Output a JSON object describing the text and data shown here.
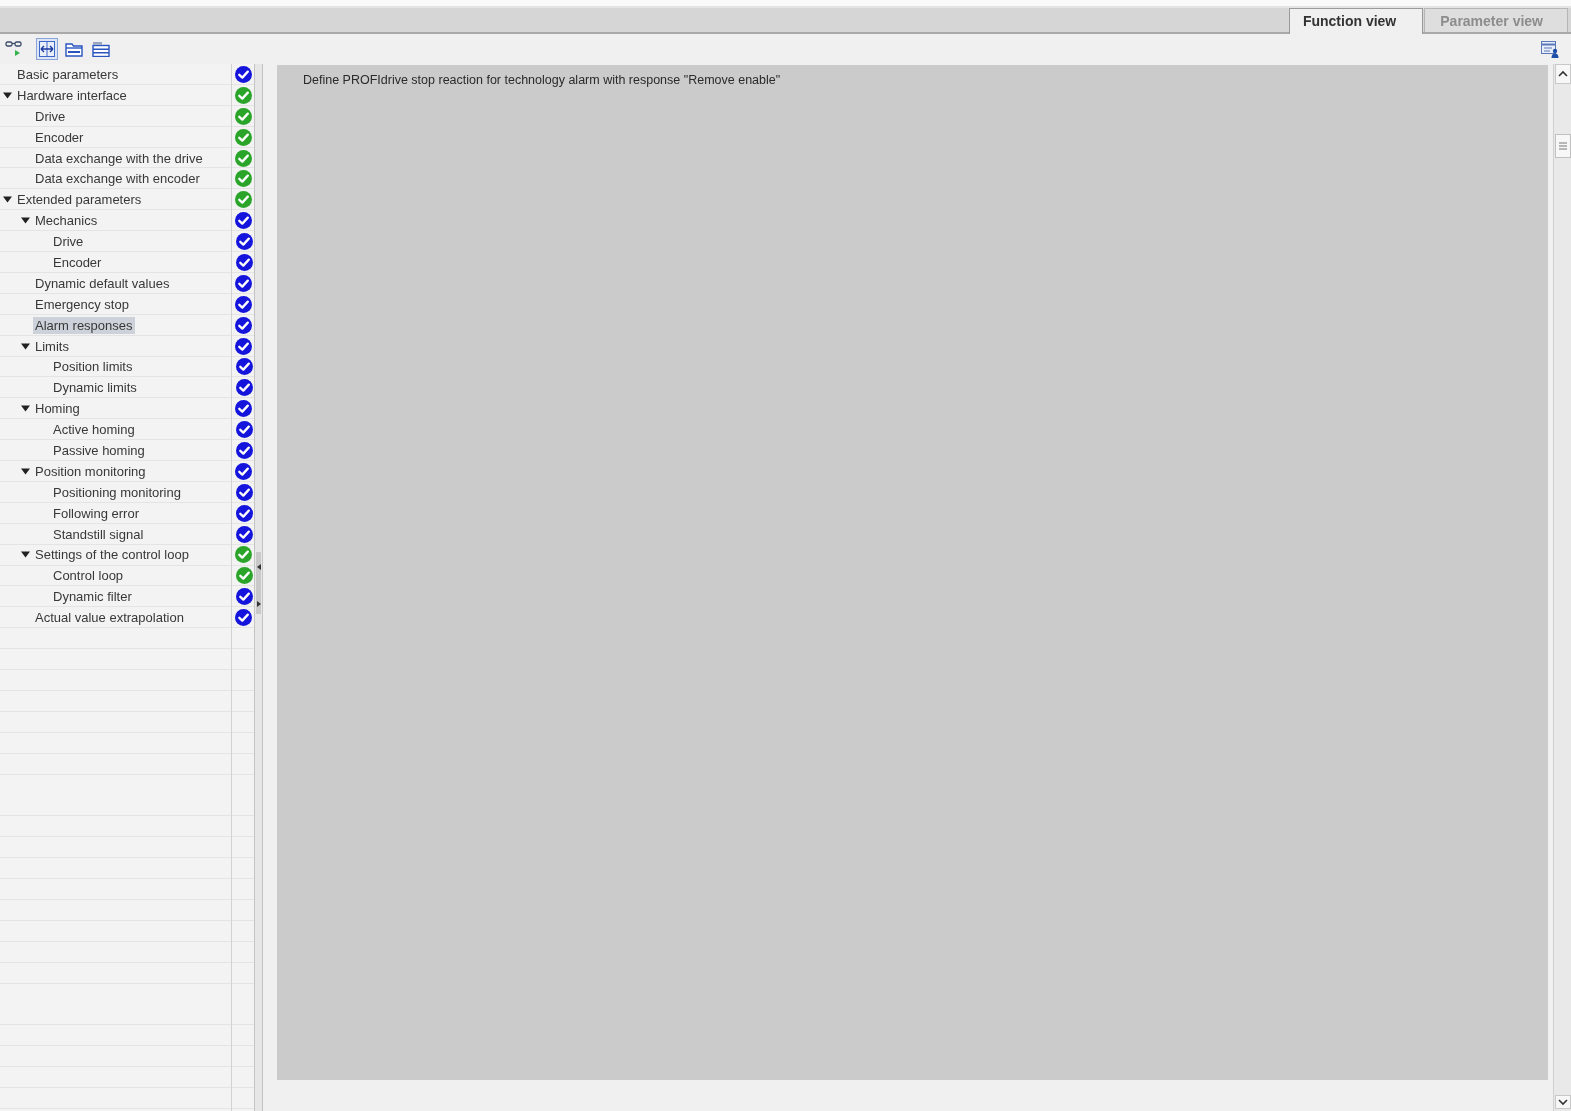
{
  "view_tabs": [
    {
      "label": "Function view",
      "selected": true
    },
    {
      "label": "Parameter view",
      "selected": false
    }
  ],
  "toolbar": {
    "buttons": [
      {
        "kind": "glasses",
        "selected": false
      },
      {
        "kind": "arrows",
        "selected": true
      },
      {
        "kind": "folder",
        "selected": false
      },
      {
        "kind": "list",
        "selected": false
      }
    ]
  },
  "navigation_tree": [
    {
      "label": "Basic parameters",
      "color": "#1414dc",
      "selected": false
    },
    {
      "label": "Hardware interface",
      "color": "#2aa52a",
      "selected": false,
      "expanded": true,
      "children": [
        {
          "label": "Drive",
          "color": "#2aa52a",
          "selected": false
        },
        {
          "label": "Encoder",
          "color": "#2aa52a",
          "selected": false
        },
        {
          "label": "Data exchange with the drive",
          "color": "#2aa52a",
          "selected": false
        },
        {
          "label": "Data exchange with encoder",
          "color": "#2aa52a",
          "selected": false
        }
      ]
    },
    {
      "label": "Extended parameters",
      "color": "#2aa52a",
      "selected": false,
      "expanded": true,
      "children": [
        {
          "label": "Mechanics",
          "color": "#1414dc",
          "selected": false,
          "expanded": true,
          "children": [
            {
              "label": "Drive",
              "color": "#1414dc",
              "selected": false
            },
            {
              "label": "Encoder",
              "color": "#1414dc",
              "selected": false
            }
          ]
        },
        {
          "label": "Dynamic default values",
          "color": "#1414dc",
          "selected": false
        },
        {
          "label": "Emergency stop",
          "color": "#1414dc",
          "selected": false
        },
        {
          "label": "Alarm responses",
          "color": "#1414dc",
          "selected": true
        },
        {
          "label": "Limits",
          "color": "#1414dc",
          "selected": false,
          "expanded": true,
          "children": [
            {
              "label": "Position limits",
              "color": "#1414dc",
              "selected": false
            },
            {
              "label": "Dynamic limits",
              "color": "#1414dc",
              "selected": false
            }
          ]
        },
        {
          "label": "Homing",
          "color": "#1414dc",
          "selected": false,
          "expanded": true,
          "children": [
            {
              "label": "Active homing",
              "color": "#1414dc",
              "selected": false
            },
            {
              "label": "Passive homing",
              "color": "#1414dc",
              "selected": false
            }
          ]
        },
        {
          "label": "Position monitoring",
          "color": "#1414dc",
          "selected": false,
          "expanded": true,
          "children": [
            {
              "label": "Positioning monitoring",
              "color": "#1414dc",
              "selected": false
            },
            {
              "label": "Following error",
              "color": "#1414dc",
              "selected": false
            },
            {
              "label": "Standstill signal",
              "color": "#1414dc",
              "selected": false
            }
          ]
        },
        {
          "label": "Settings of the control loop",
          "color": "#2aa52a",
          "selected": false,
          "expanded": true,
          "children": [
            {
              "label": "Control loop",
              "color": "#2aa52a",
              "selected": false
            },
            {
              "label": "Dynamic filter",
              "color": "#1414dc",
              "selected": false
            }
          ]
        },
        {
          "label": "Actual value extrapolation",
          "color": "#1414dc",
          "selected": false
        }
      ]
    }
  ],
  "content": {
    "description": "Define PROFIdrive stop reaction for technology alarm with response \"Remove enable\""
  }
}
